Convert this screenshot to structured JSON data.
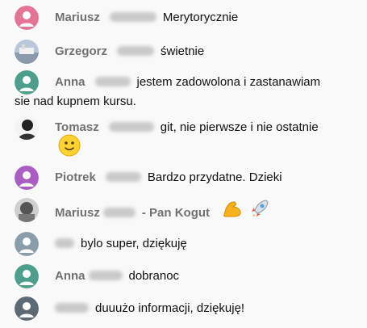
{
  "messages": [
    {
      "author": "Mariusz",
      "text": "Merytorycznie",
      "avatar_color": "#e57393"
    },
    {
      "author": "Grzegorz",
      "text": "świetnie",
      "avatar_color": "#8aa4bd"
    },
    {
      "author": "Anna",
      "text": "jestem zadowolona i zastanawiam",
      "text2": "sie nad kupnem kursu.",
      "avatar_color": "#4e9e8c"
    },
    {
      "author": "Tomasz",
      "text": "git, nie pierwsze i nie ostatnie",
      "avatar_color": "#2a2a2a",
      "emoji": "slightly-smiling-face"
    },
    {
      "author": "Piotrek",
      "text": "Bardzo przydatne. Dzieki",
      "avatar_color": "#a95ec4"
    },
    {
      "author": "Mariusz",
      "author_suffix": "- Pan Kogut",
      "text": "",
      "avatar_color": "#9a9a9a",
      "emojis": [
        "flexed-biceps",
        "rocket"
      ]
    },
    {
      "author": "",
      "text": "bylo super, dziękuję",
      "avatar_color": "#8a9dab"
    },
    {
      "author": "Anna",
      "text": "dobranoc",
      "avatar_color": "#4e9e8c"
    },
    {
      "author": "",
      "text": "duuużo informacji, dziękuję!",
      "avatar_color": "#5d6a75"
    }
  ]
}
